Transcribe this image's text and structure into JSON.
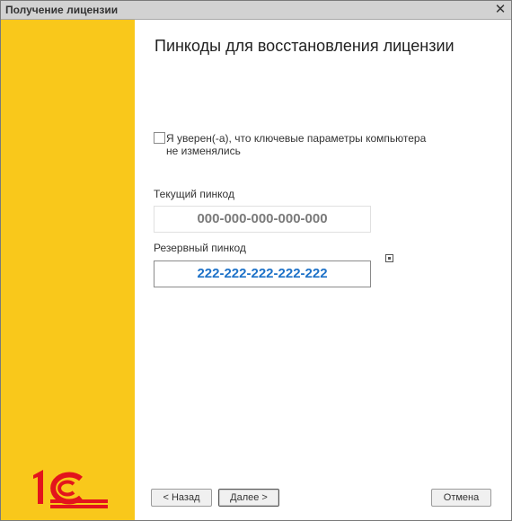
{
  "window": {
    "title": "Получение лицензии",
    "close_glyph": "✕"
  },
  "icons": {
    "close": "close-icon",
    "logo": "1c-logo",
    "pin_action": "small-square-icon"
  },
  "colors": {
    "sidebar": "#f9c81b",
    "logo_red": "#e3141c",
    "reserve_pin": "#1e72c8",
    "current_pin": "#7a7a7a"
  },
  "main": {
    "heading": "Пинкоды для восстановления лицензии",
    "checkbox": {
      "label_line1": "Я уверен(-а), что ключевые параметры компьютера",
      "label_line2": "не изменялись",
      "checked": false
    },
    "current_pin": {
      "label": "Текущий пинкод",
      "value": "000-000-000-000-000"
    },
    "reserve_pin": {
      "label": "Резервный пинкод",
      "value": "222-222-222-222-222"
    }
  },
  "buttons": {
    "back": "< Назад",
    "next": "Далее >",
    "cancel": "Отмена"
  }
}
